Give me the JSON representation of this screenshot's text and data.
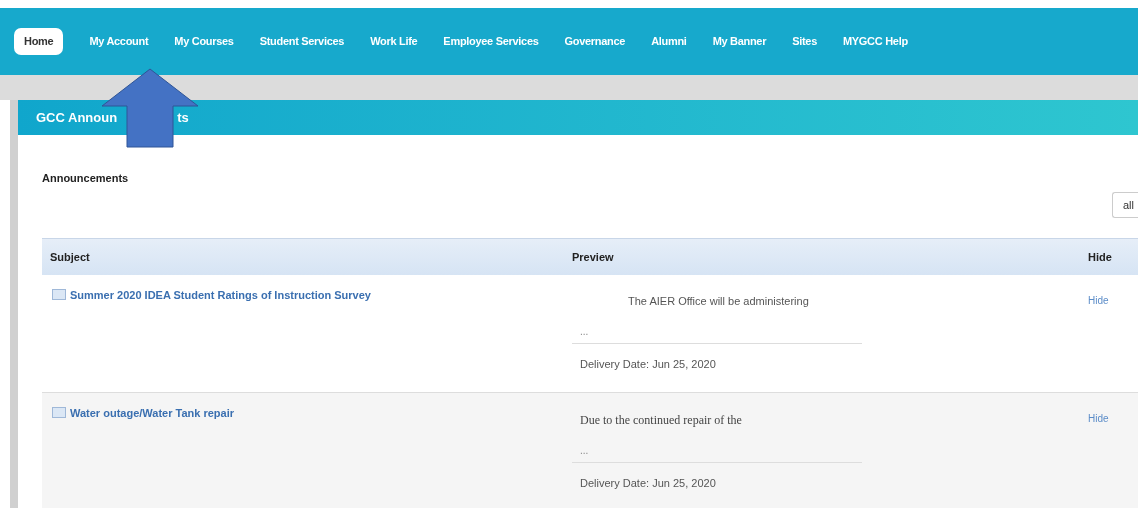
{
  "nav": [
    {
      "label": "Home",
      "selected": true
    },
    {
      "label": "My Account",
      "selected": false
    },
    {
      "label": "My Courses",
      "selected": false
    },
    {
      "label": "Student Services",
      "selected": false
    },
    {
      "label": "Work Life",
      "selected": false
    },
    {
      "label": "Employee Services",
      "selected": false
    },
    {
      "label": "Governance",
      "selected": false
    },
    {
      "label": "Alumni",
      "selected": false
    },
    {
      "label": "My Banner",
      "selected": false
    },
    {
      "label": "Sites",
      "selected": false
    },
    {
      "label": "MYGCC Help",
      "selected": false
    }
  ],
  "panel": {
    "title_parts": [
      "GCC Announ",
      "ts"
    ],
    "section_title": "Announcements",
    "filter": "all"
  },
  "table": {
    "columns": [
      "Subject",
      "Preview",
      "Hide"
    ],
    "rows": [
      {
        "subject": "Summer 2020 IDEA Student Ratings of Instruction Survey",
        "preview": "The AIER Office will be administering",
        "kind": "indented",
        "ellipsis": "...",
        "delivery": "Delivery Date: Jun 25, 2020",
        "action": "Hide"
      },
      {
        "subject": "Water outage/Water Tank repair",
        "preview": "Due to the continued repair of the",
        "kind": "serif",
        "ellipsis": "...",
        "delivery": "Delivery Date: Jun 25, 2020",
        "action": "Hide"
      }
    ]
  }
}
